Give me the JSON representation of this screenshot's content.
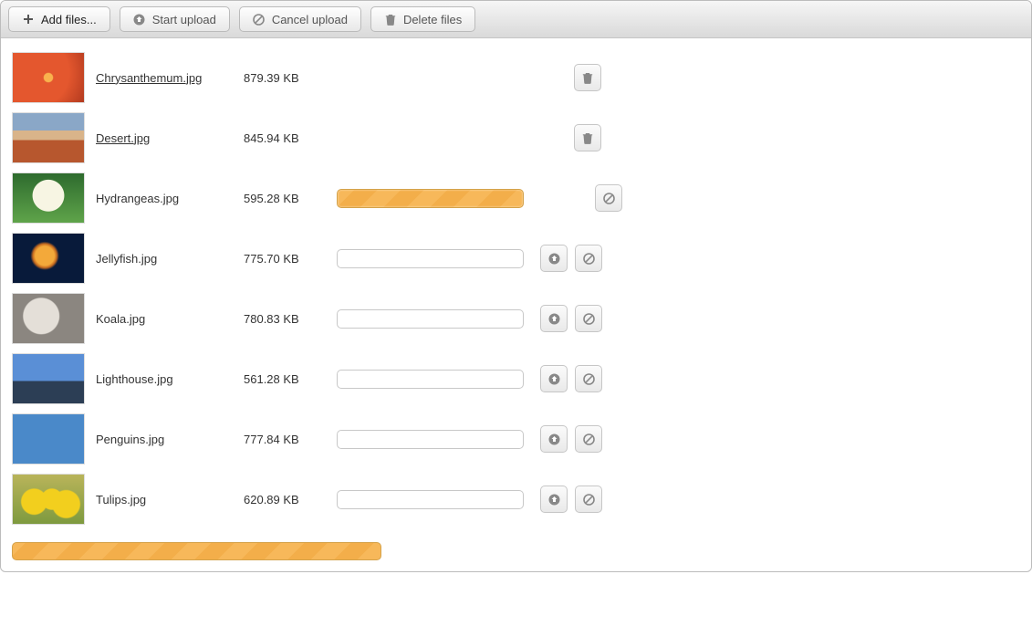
{
  "toolbar": {
    "add_files_label": "Add files...",
    "start_upload_label": "Start upload",
    "cancel_upload_label": "Cancel upload",
    "delete_files_label": "Delete files"
  },
  "icons": {
    "plus": "plus-icon",
    "upload": "upload-arrow-icon",
    "cancel": "cancel-circle-icon",
    "trash": "trash-icon"
  },
  "files": [
    {
      "name": "Chrysanthemum.jpg",
      "size": "879.39 KB",
      "state": "uploaded",
      "thumb": "t-orange",
      "actions": [
        "delete"
      ]
    },
    {
      "name": "Desert.jpg",
      "size": "845.94 KB",
      "state": "uploaded",
      "thumb": "t-desert",
      "actions": [
        "delete"
      ]
    },
    {
      "name": "Hydrangeas.jpg",
      "size": "595.28 KB",
      "state": "uploading",
      "thumb": "t-hydrangea",
      "actions": [
        "cancel"
      ]
    },
    {
      "name": "Jellyfish.jpg",
      "size": "775.70 KB",
      "state": "queued",
      "thumb": "t-jelly",
      "actions": [
        "start",
        "cancel"
      ]
    },
    {
      "name": "Koala.jpg",
      "size": "780.83 KB",
      "state": "queued",
      "thumb": "t-koala",
      "actions": [
        "start",
        "cancel"
      ]
    },
    {
      "name": "Lighthouse.jpg",
      "size": "561.28 KB",
      "state": "queued",
      "thumb": "t-lighthouse",
      "actions": [
        "start",
        "cancel"
      ]
    },
    {
      "name": "Penguins.jpg",
      "size": "777.84 KB",
      "state": "queued",
      "thumb": "t-penguins",
      "actions": [
        "start",
        "cancel"
      ]
    },
    {
      "name": "Tulips.jpg",
      "size": "620.89 KB",
      "state": "queued",
      "thumb": "t-tulips",
      "actions": [
        "start",
        "cancel"
      ]
    }
  ],
  "overall_progress": {
    "visible": true
  }
}
